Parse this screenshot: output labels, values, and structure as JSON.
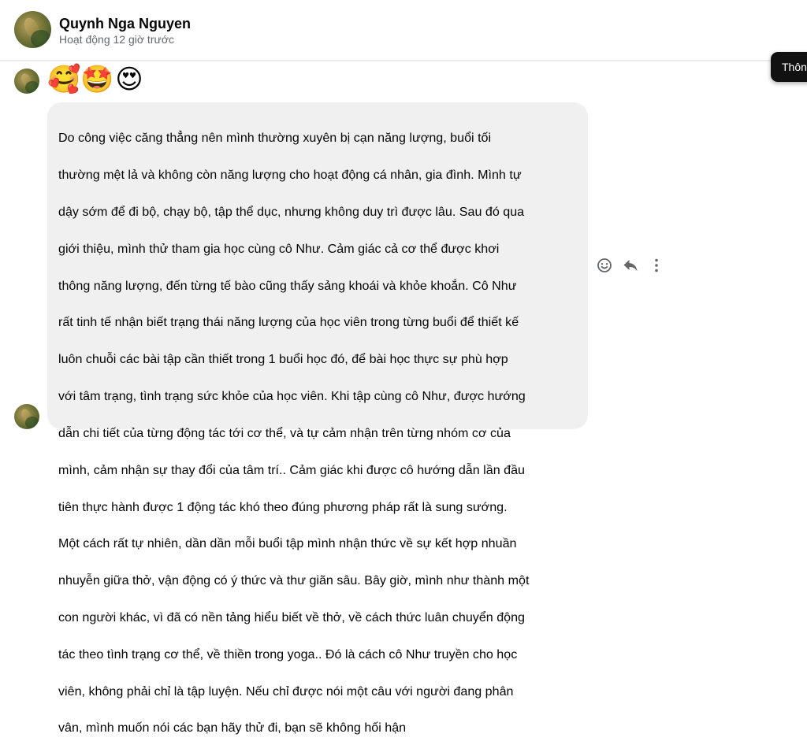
{
  "header": {
    "contact_name": "Quynh Nga Nguyen",
    "status": "Hoạt động 12 giờ trước",
    "tooltip_label": "Thôn"
  },
  "emoji_message": {
    "emojis": [
      "🥰",
      "🤩",
      "😍"
    ]
  },
  "text_message": {
    "lines": [
      "Do công việc căng thẳng nên mình thường xuyên bị cạn năng lượng, buổi tối",
      "thường mệt lả và không còn năng lượng cho hoạt động cá nhân, gia đình. Mình tự",
      "dậy sớm để đi bộ, chạy bộ, tập thể dục, nhưng không duy trì được lâu. Sau đó qua",
      "giới thiệu, mình thử tham gia học cùng cô Như. Cảm giác cả cơ thể được khơi",
      "thông năng lượng, đến từng tế bào cũng thấy sảng khoái và khỏe khoắn. Cô Như",
      "rất tinh tế nhận biết trạng thái năng lượng của học viên trong từng buổi để thiết kế",
      "luôn chuỗi các bài tập cần thiết trong 1 buổi học đó, để bài học thực sự phù hợp",
      "với tâm trạng, tình trạng sức khỏe của học viên. Khi tập cùng cô Như, được hướng",
      "dẫn chi tiết của từng động tác tới cơ thể, và tự cảm nhận trên từng nhóm cơ của",
      "mình, cảm nhận sự thay đổi của tâm trí.. Cảm giác khi được cô hướng dẫn lần đầu",
      "tiên thực hành được 1 động tác khó theo đúng phương pháp rất là sung sướng.",
      "Một cách rất tự nhiên, dần dần mỗi buổi tập mình nhận thức về sự kết hợp nhuần",
      "nhuyễn giữa thở, vận động có ý thức và thư giãn sâu. Bây giờ, mình như thành một",
      "con người khác, vì đã có nền tảng hiểu biết về thở, về cách thức luân chuyển động",
      "tác theo tình trạng cơ thể, về thiền trong yoga.. Đó là cách cô Như truyền cho học",
      "viên, không phải chỉ là tập luyện. Nếu chỉ được nói một câu với người đang phân",
      "vân, mình muốn nói các bạn hãy thử đi, bạn sẽ không hối hận"
    ]
  },
  "message_actions": {
    "icons": [
      "smiley-icon",
      "reply-icon",
      "more-dots-icon"
    ]
  },
  "colors": {
    "bubble_bg": "#f0f0f0",
    "secondary_text": "#65676b",
    "tooltip_bg": "#111111"
  }
}
